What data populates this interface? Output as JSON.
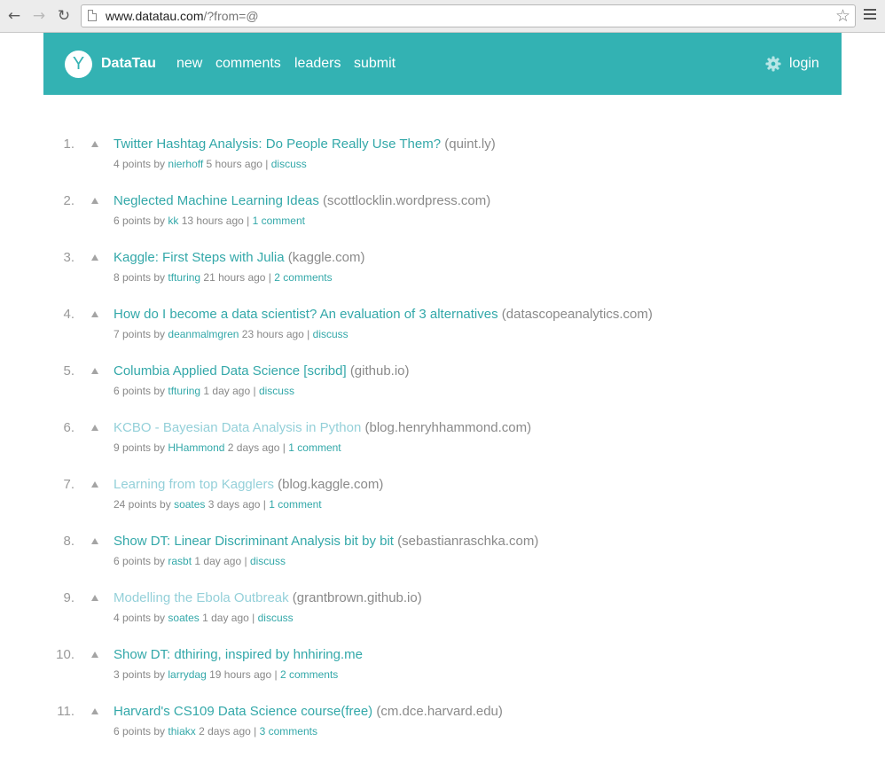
{
  "browser": {
    "url_host": "www.datatau.com",
    "url_path": "/?from=@"
  },
  "colors": {
    "accent": "#33b2b3",
    "link": "#33a8a9",
    "visited_link": "#94d0d9",
    "meta_text": "#888888"
  },
  "header": {
    "logo_letter": "Y",
    "brand": "DataTau",
    "nav": [
      "new",
      "comments",
      "leaders",
      "submit"
    ],
    "login": "login"
  },
  "stories": [
    {
      "rank": "1.",
      "title": "Twitter Hashtag Analysis: Do People Really Use Them?",
      "domain": "(quint.ly)",
      "points": "4 points by",
      "user": "nierhoff",
      "age": "5 hours ago |",
      "comments": "discuss",
      "visited": false
    },
    {
      "rank": "2.",
      "title": "Neglected Machine Learning Ideas",
      "domain": "(scottlocklin.wordpress.com)",
      "points": "6 points by",
      "user": "kk",
      "age": "13 hours ago |",
      "comments": "1 comment",
      "visited": false
    },
    {
      "rank": "3.",
      "title": "Kaggle: First Steps with Julia",
      "domain": "(kaggle.com)",
      "points": "8 points by",
      "user": "tfturing",
      "age": "21 hours ago |",
      "comments": "2 comments",
      "visited": false
    },
    {
      "rank": "4.",
      "title": "How do I become a data scientist? An evaluation of 3 alternatives",
      "domain": "(datascopeanalytics.com)",
      "points": "7 points by",
      "user": "deanmalmgren",
      "age": "23 hours ago |",
      "comments": "discuss",
      "visited": false
    },
    {
      "rank": "5.",
      "title": "Columbia Applied Data Science [scribd]",
      "domain": "(github.io)",
      "points": "6 points by",
      "user": "tfturing",
      "age": "1 day ago |",
      "comments": "discuss",
      "visited": false
    },
    {
      "rank": "6.",
      "title": "KCBO - Bayesian Data Analysis in Python",
      "domain": "(blog.henryhhammond.com)",
      "points": "9 points by",
      "user": "HHammond",
      "age": "2 days ago |",
      "comments": "1 comment",
      "visited": true
    },
    {
      "rank": "7.",
      "title": "Learning from top Kagglers",
      "domain": "(blog.kaggle.com)",
      "points": "24 points by",
      "user": "soates",
      "age": "3 days ago |",
      "comments": "1 comment",
      "visited": true
    },
    {
      "rank": "8.",
      "title": "Show DT: Linear Discriminant Analysis bit by bit",
      "domain": "(sebastianraschka.com)",
      "points": "6 points by",
      "user": "rasbt",
      "age": "1 day ago |",
      "comments": "discuss",
      "visited": false
    },
    {
      "rank": "9.",
      "title": "Modelling the Ebola Outbreak",
      "domain": "(grantbrown.github.io)",
      "points": "4 points by",
      "user": "soates",
      "age": "1 day ago |",
      "comments": "discuss",
      "visited": true
    },
    {
      "rank": "10.",
      "title": "Show DT: dthiring, inspired by hnhiring.me",
      "domain": "",
      "points": "3 points by",
      "user": "larrydag",
      "age": "19 hours ago |",
      "comments": "2 comments",
      "visited": false
    },
    {
      "rank": "11.",
      "title": "Harvard's CS109 Data Science course(free)",
      "domain": "(cm.dce.harvard.edu)",
      "points": "6 points by",
      "user": "thiakx",
      "age": "2 days ago |",
      "comments": "3 comments",
      "visited": false
    }
  ]
}
